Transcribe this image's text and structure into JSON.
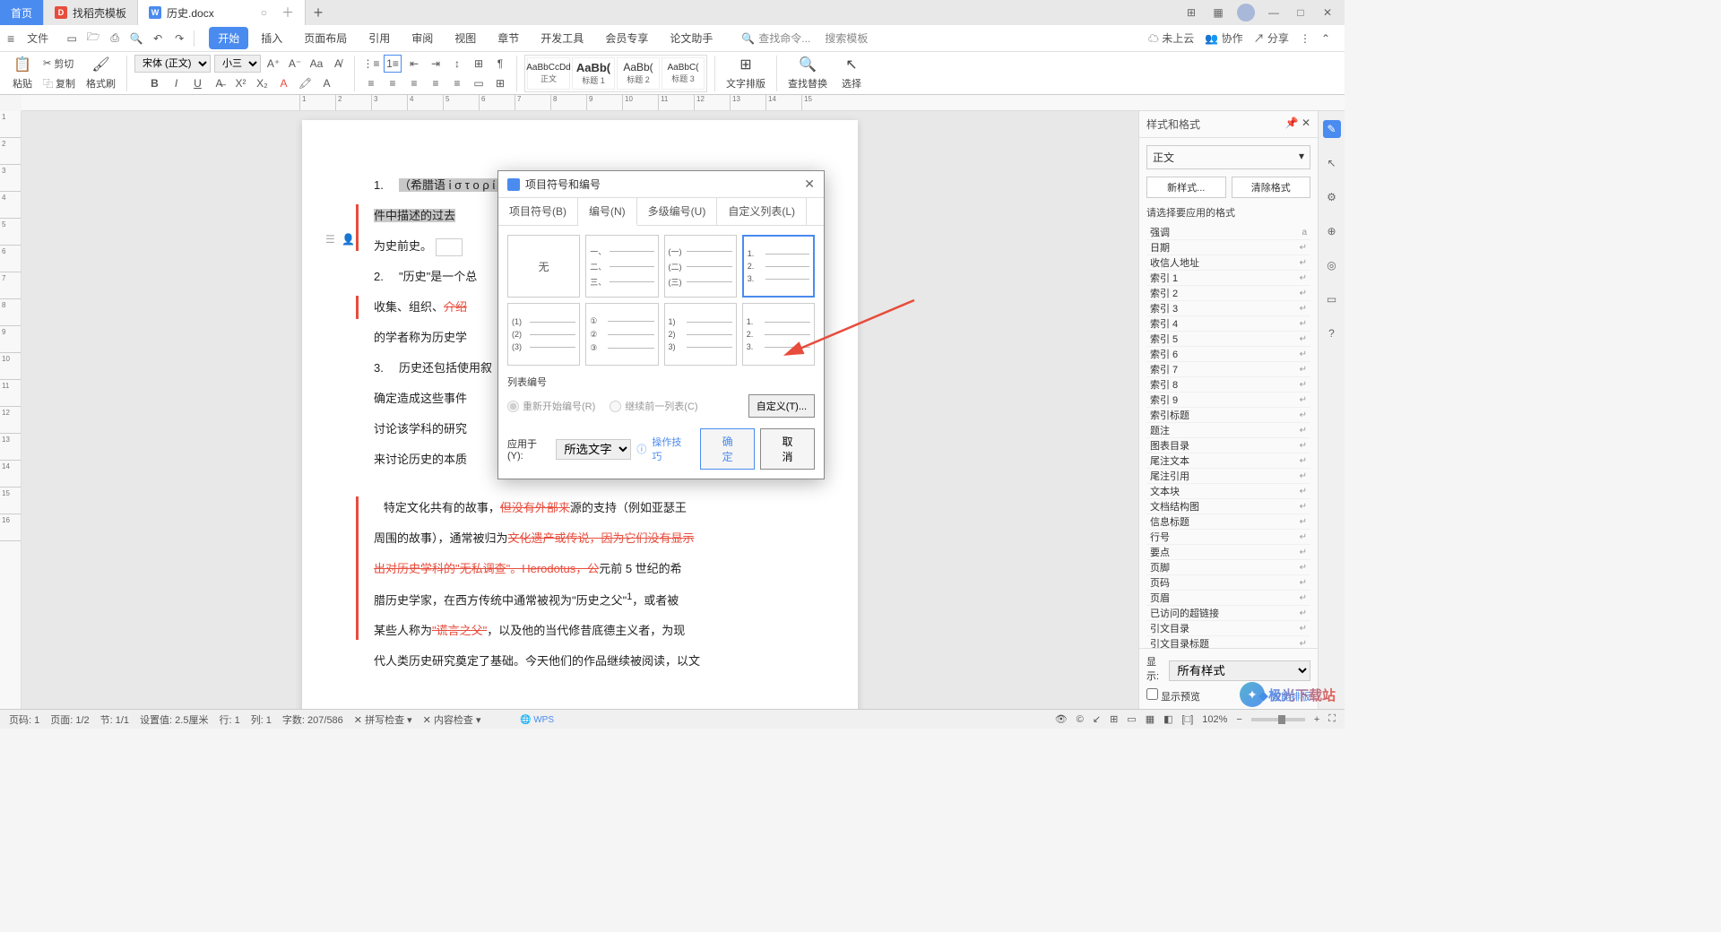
{
  "tabs": {
    "home": "首页",
    "template": "找稻壳模板",
    "doc": "历史.docx"
  },
  "menu": {
    "file": "文件",
    "items": [
      "开始",
      "插入",
      "页面布局",
      "引用",
      "审阅",
      "视图",
      "章节",
      "开发工具",
      "会员专享",
      "论文助手"
    ],
    "search_cmd": "查找命令...",
    "search_tpl": "搜索模板"
  },
  "menu_right": {
    "cloud": "未上云",
    "coop": "协作",
    "share": "分享"
  },
  "ribbon": {
    "paste": "粘贴",
    "cut": "剪切",
    "copy": "复制",
    "format_painter": "格式刷",
    "font": "宋体 (正文)",
    "size": "小三",
    "styles": [
      {
        "preview": "AaBbCcDd",
        "label": "正文"
      },
      {
        "preview": "AaBb(",
        "label": "标题 1"
      },
      {
        "preview": "AaBb(",
        "label": "标题 2"
      },
      {
        "preview": "AaBbC(",
        "label": "标题 3"
      }
    ],
    "text_layout": "文字排版",
    "find_replace": "查找替换",
    "select": "选择"
  },
  "document": {
    "line1_pre": "（希腊语 ἱ σ τ ο ρ ί α，通过调查获得的知识\"）是书面文",
    "line1_suf": "件中描述的过去",
    "line1_end": "为史前史。",
    "list2_a": "\"历史\"是一个总",
    "list2_b": "收集、组织、",
    "list2_c": "的学者称为历史学",
    "list3_a": "历史还包括使用叙",
    "list3_b": "确定造成这些事件",
    "list3_c": "讨论该学科的研究",
    "list3_d": "来讨论历史的本质",
    "para2_a": "特定文化共有的故事，",
    "para2_strike1": "但没有外部来",
    "para2_b": "源的支持（例如亚瑟王",
    "para2_c": "周围的故事），通常被归为",
    "para2_strike2": "文化遗产或传说，因为它们没有显示",
    "para2_strike3": "出对历史学科的\"无私调查\"。Herodotus，公",
    "para2_d": "元前 5 世纪的希",
    "para2_e": "腊历史学家，在西方传统中通常被视为\"历史之父\"",
    "para2_f": "，或者被",
    "para2_g": "某些人称为",
    "para2_strike4": "\"谎言之父\"",
    "para2_h": "，以及他的当代修昔底德主义者，为现",
    "para2_i": "代人类历史研究奠定了基础。今天他们的作品继续被阅读，以文"
  },
  "dialog": {
    "title": "项目符号和编号",
    "tabs": [
      "项目符号(B)",
      "编号(N)",
      "多级编号(U)",
      "自定义列表(L)"
    ],
    "none": "无",
    "list_num": "列表编号",
    "radio1": "重新开始编号(R)",
    "radio2": "继续前一列表(C)",
    "custom": "自定义(T)...",
    "apply_to": "应用于(Y):",
    "apply_sel": "所选文字",
    "help": "操作技巧",
    "ok": "确定",
    "cancel": "取消"
  },
  "styles_panel": {
    "title": "样式和格式",
    "current": "正文",
    "new_style": "新样式...",
    "clear": "清除格式",
    "choose": "请选择要应用的格式",
    "list": [
      "强调",
      "日期",
      "收信人地址",
      "索引 1",
      "索引 2",
      "索引 3",
      "索引 4",
      "索引 5",
      "索引 6",
      "索引 7",
      "索引 8",
      "索引 9",
      "索引标题",
      "题注",
      "图表目录",
      "尾注文本",
      "尾注引用",
      "文本块",
      "文档结构图",
      "信息标题",
      "行号",
      "要点",
      "页脚",
      "页码",
      "页眉",
      "已访问的超链接",
      "引文目录",
      "引文目录标题",
      "正文"
    ],
    "show": "显示:",
    "show_val": "所有样式",
    "preview": "显示预览",
    "smart": "智能排版"
  },
  "status": {
    "page_num": "页码: 1",
    "page": "页面: 1/2",
    "section": "节: 1/1",
    "pos": "设置值: 2.5厘米",
    "line": "行: 1",
    "col": "列: 1",
    "words": "字数: 207/586",
    "spell": "拼写检查",
    "content": "内容检查",
    "zoom": "102%"
  },
  "watermark": "极光下载站"
}
